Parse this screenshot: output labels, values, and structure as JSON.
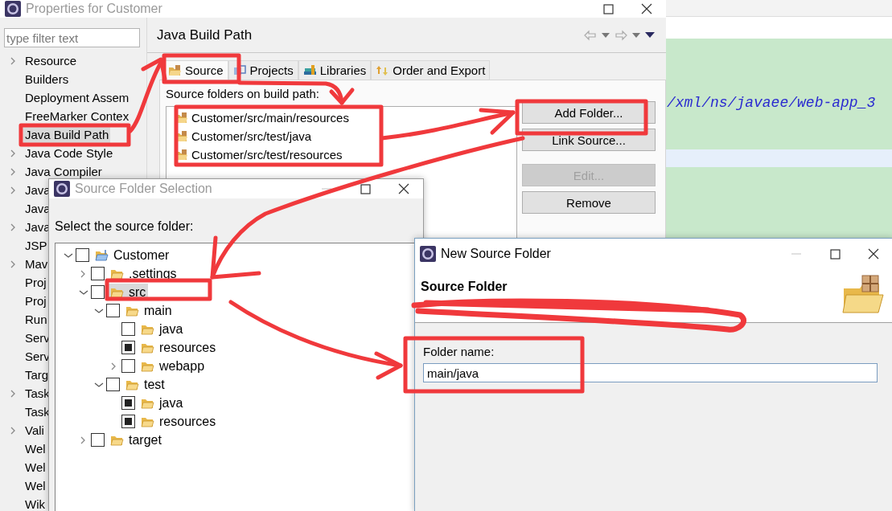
{
  "editor": {
    "code_line": "/xml/ns/javaee/web-app_3"
  },
  "properties_window": {
    "title": "Properties for Customer",
    "active": false,
    "filter": {
      "placeholder": "type filter text"
    },
    "sidebar": {
      "items": [
        {
          "label": "Resource",
          "expanded": false,
          "selected": false
        },
        {
          "label": "Builders",
          "selected": false
        },
        {
          "label": "Deployment Assem",
          "selected": false
        },
        {
          "label": "FreeMarker Contex",
          "selected": false
        },
        {
          "label": "Java Build Path",
          "selected": true
        },
        {
          "label": "Java Code Style",
          "expanded": false,
          "selected": false
        },
        {
          "label": "Java Compiler",
          "expanded": false,
          "selected": false
        },
        {
          "label": "Java",
          "expanded": false,
          "selected": false
        },
        {
          "label": "Java",
          "selected": false
        },
        {
          "label": "Java",
          "expanded": false,
          "selected": false
        },
        {
          "label": "JSP",
          "selected": false
        },
        {
          "label": "Mav",
          "expanded": false,
          "selected": false
        },
        {
          "label": "Proj",
          "selected": false
        },
        {
          "label": "Proj",
          "selected": false
        },
        {
          "label": "Run",
          "selected": false
        },
        {
          "label": "Serv",
          "selected": false
        },
        {
          "label": "Serv",
          "selected": false
        },
        {
          "label": "Targ",
          "selected": false
        },
        {
          "label": "Task",
          "expanded": false,
          "selected": false
        },
        {
          "label": "Task",
          "selected": false
        },
        {
          "label": "Vali",
          "expanded": false,
          "selected": false
        },
        {
          "label": "Wel",
          "selected": false
        },
        {
          "label": "Wel",
          "selected": false
        },
        {
          "label": "Wel",
          "selected": false
        },
        {
          "label": "Wik",
          "selected": false
        }
      ]
    },
    "page": {
      "title": "Java Build Path",
      "tabs": [
        {
          "label": "Source",
          "selected": true
        },
        {
          "label": "Projects",
          "selected": false
        },
        {
          "label": "Libraries",
          "selected": false
        },
        {
          "label": "Order and Export",
          "selected": false
        }
      ],
      "list_label": "Source folders on build path:",
      "source_folders": [
        "Customer/src/main/resources",
        "Customer/src/test/java",
        "Customer/src/test/resources"
      ],
      "buttons": [
        {
          "label": "Add Folder...",
          "disabled": false
        },
        {
          "label": "Link Source...",
          "disabled": false
        },
        {
          "label": "Edit...",
          "disabled": true
        },
        {
          "label": "Remove",
          "disabled": false
        }
      ]
    }
  },
  "selection_dialog": {
    "title": "Source Folder Selection",
    "active": false,
    "prompt": "Select the source folder:",
    "tree": [
      {
        "label": "Customer",
        "kind": "project",
        "expanded": true,
        "checked": false,
        "selected": false,
        "children": [
          {
            "label": ".settings",
            "kind": "folder",
            "expanded": false,
            "checked": false,
            "selected": false
          },
          {
            "label": "src",
            "kind": "folder",
            "expanded": true,
            "checked": false,
            "selected": true,
            "children": [
              {
                "label": "main",
                "kind": "folder",
                "expanded": true,
                "checked": false,
                "selected": false,
                "children": [
                  {
                    "label": "java",
                    "kind": "folder",
                    "checked": false,
                    "selected": false
                  },
                  {
                    "label": "resources",
                    "kind": "folder",
                    "checked": true,
                    "selected": false
                  },
                  {
                    "label": "webapp",
                    "kind": "folder",
                    "expanded": false,
                    "checked": false,
                    "selected": false
                  }
                ]
              },
              {
                "label": "test",
                "kind": "folder",
                "expanded": true,
                "checked": false,
                "selected": false,
                "children": [
                  {
                    "label": "java",
                    "kind": "folder",
                    "checked": true,
                    "selected": false
                  },
                  {
                    "label": "resources",
                    "kind": "folder",
                    "checked": true,
                    "selected": false
                  }
                ]
              }
            ]
          },
          {
            "label": "target",
            "kind": "folder",
            "expanded": false,
            "checked": false,
            "selected": false
          }
        ]
      }
    ]
  },
  "new_folder_dialog": {
    "title": "New Source Folder",
    "active": true,
    "heading": "Source Folder",
    "folder_name_label": "Folder name:",
    "folder_name": "main/java"
  }
}
